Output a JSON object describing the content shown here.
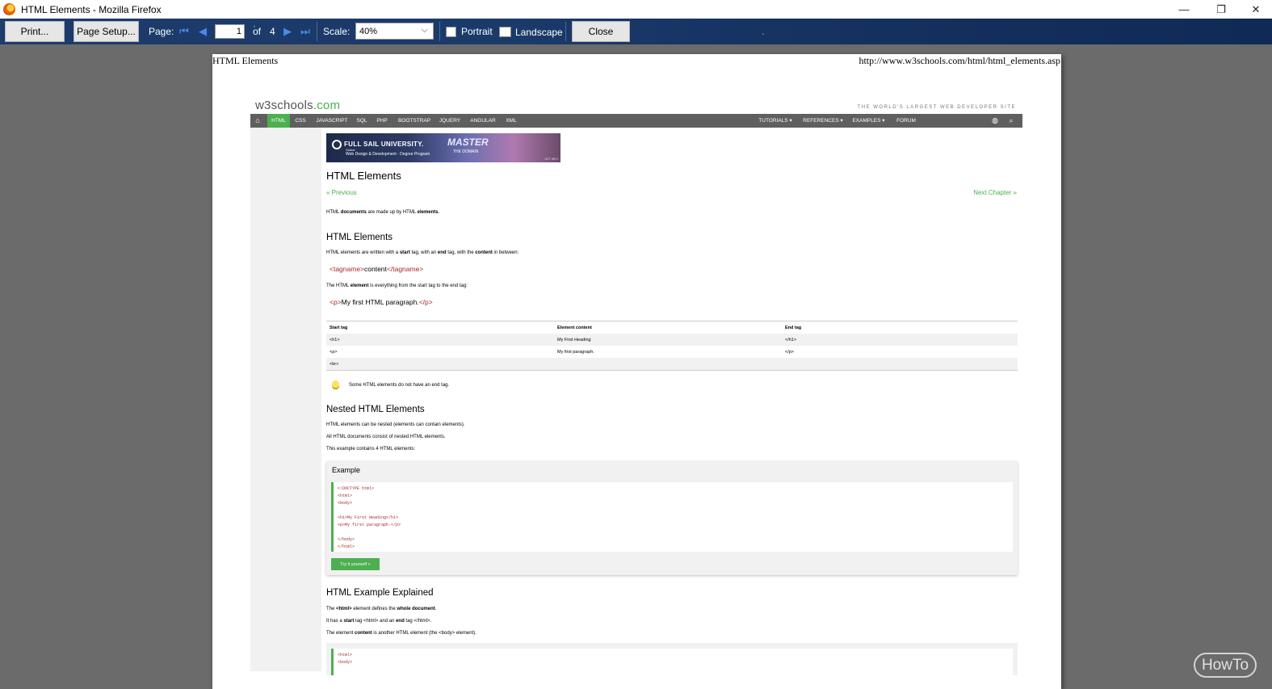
{
  "window": {
    "title": "HTML Elements - Mozilla Firefox",
    "minimize": "—",
    "restore": "❐",
    "close": "✕"
  },
  "toolbar": {
    "print_label": "Print...",
    "page_setup_label": "Page Setup...",
    "page_label": "Page:",
    "page_value": "1",
    "of_label": "of",
    "total_pages": "4",
    "scale_label": "Scale:",
    "scale_value": "40%",
    "portrait_label": "Portrait",
    "landscape_label": "Landscape",
    "close_label": "Close"
  },
  "page_header": {
    "left": "HTML Elements",
    "right": "http://www.w3schools.com/html/html_elements.asp"
  },
  "w3": {
    "logo_main": "w3schools",
    "logo_com": ".com",
    "tagline": "THE WORLD'S LARGEST WEB DEVELOPER SITE",
    "nav": [
      "HTML",
      "CSS",
      "JAVASCRIPT",
      "SQL",
      "PHP",
      "BOOTSTRAP",
      "JQUERY",
      "ANGULAR",
      "XML"
    ],
    "nav_right": [
      "TUTORIALS ▾",
      "REFERENCES ▾",
      "EXAMPLES ▾",
      "FORUM"
    ],
    "ad": {
      "title": "FULL SAIL UNIVERSITY.",
      "online": "Online",
      "sub": "Web Design & Development · Degree Program",
      "master": "MASTER",
      "domain": "THE DOMAIN",
      "get": "GET INFO"
    },
    "h1": "HTML Elements",
    "prev": "« Previous",
    "next": "Next Chapter »",
    "intro_a": "HTML ",
    "intro_b": "documents",
    "intro_c": " are made up by HTML ",
    "intro_d": "elements",
    "intro_e": ".",
    "h2_elements": "HTML Elements",
    "elements_p_a": "HTML elements are written with a ",
    "elements_p_b": "start",
    "elements_p_c": " tag, with an ",
    "elements_p_d": "end",
    "elements_p_e": " tag, with the ",
    "elements_p_f": "content",
    "elements_p_g": " in between:",
    "syntax_open": "<tagname>",
    "syntax_content": "content",
    "syntax_close": "</tagname>",
    "element_p_a": "The HTML ",
    "element_p_b": "element",
    "element_p_c": " is everything from the start tag to the end tag:",
    "para_open": "<p>",
    "para_text": "My first HTML paragraph.",
    "para_close": "</p>",
    "table": {
      "headers": [
        "Start tag",
        "Element content",
        "End tag"
      ],
      "rows": [
        [
          "<h1>",
          "My First Heading",
          "</h1>"
        ],
        [
          "<p>",
          "My first paragraph.",
          "</p>"
        ],
        [
          "<br>",
          "",
          ""
        ]
      ]
    },
    "note": "Some HTML elements do not have an end tag.",
    "h2_nested": "Nested HTML Elements",
    "nested_p1": "HTML elements can be nested (elements can contain elements).",
    "nested_p2": "All HTML documents consist of nested HTML elements.",
    "nested_p3": "This example contains 4 HTML elements:",
    "example_title": "Example",
    "example_code": [
      "<!DOCTYPE html>",
      "<html>",
      "<body>",
      "",
      "<h1>My First Heading</h1>",
      "<p>My first paragraph.</p>",
      "",
      "</body>",
      "</html>"
    ],
    "try_label": "Try it yourself »",
    "h2_explained": "HTML Example Explained",
    "exp_p1_a": "The ",
    "exp_p1_b": "<html>",
    "exp_p1_c": " element defines the ",
    "exp_p1_d": "whole document",
    "exp_p1_e": ".",
    "exp_p2_a": "It has a ",
    "exp_p2_b": "start",
    "exp_p2_c": " tag <html> and an ",
    "exp_p2_d": "end",
    "exp_p2_e": " tag </html>.",
    "exp_p3_a": "The element ",
    "exp_p3_b": "content",
    "exp_p3_c": " is another HTML element (the <body> element).",
    "example2_code": [
      "<html>",
      "<body>"
    ]
  },
  "watermark": "HowTo"
}
